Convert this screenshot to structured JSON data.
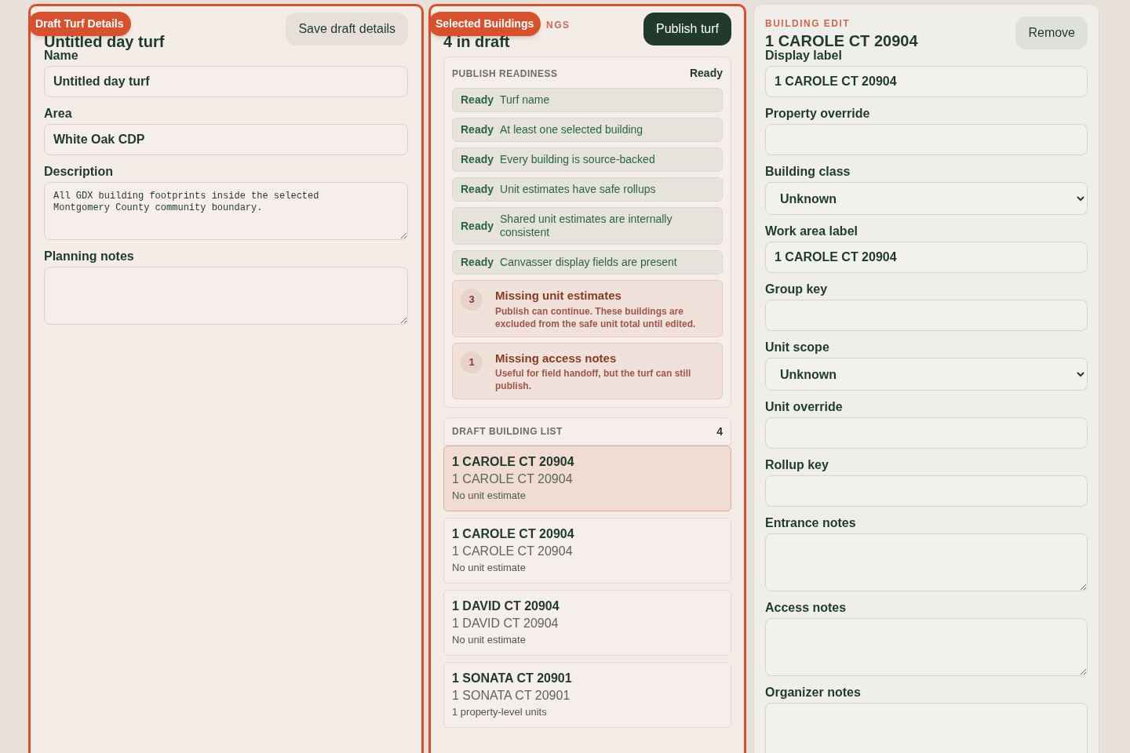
{
  "draft_panel": {
    "badge": "Draft Turf Details",
    "title": "Untitled day turf",
    "button": "Save draft details",
    "highlighted": true,
    "fields": [
      {
        "kind": "input",
        "label": "Name",
        "value": "Untitled day turf"
      },
      {
        "kind": "input",
        "label": "Area",
        "value": "White Oak CDP"
      },
      {
        "kind": "textarea",
        "label": "Description",
        "value": "All GDX building footprints inside the selected Montgomery County community boundary."
      },
      {
        "kind": "textarea",
        "label": "Planning notes"
      }
    ]
  },
  "buildings_panel": {
    "badge": "Selected Buildings",
    "eyebrow": "NGS",
    "title": "4 in draft",
    "button": "Publish turf",
    "highlighted": true,
    "readiness": {
      "heading": "PUBLISH READINESS",
      "status": "Ready",
      "checks": [
        {
          "status": "Ready",
          "label": "Turf name"
        },
        {
          "status": "Ready",
          "label": "At least one selected building"
        },
        {
          "status": "Ready",
          "label": "Every building is source-backed"
        },
        {
          "status": "Ready",
          "label": "Unit estimates have safe rollups"
        },
        {
          "status": "Ready",
          "label": "Shared unit estimates are internally consistent"
        },
        {
          "status": "Ready",
          "label": "Canvasser display fields are present"
        }
      ],
      "warnings": [
        {
          "count": "3",
          "title": "Missing unit estimates",
          "text": "Publish can continue. These buildings are excluded from the safe unit total until edited."
        },
        {
          "count": "1",
          "title": "Missing access notes",
          "text": "Useful for field handoff, but the turf can still publish."
        }
      ]
    },
    "list": {
      "heading": "DRAFT BUILDING LIST",
      "count": "4",
      "items": [
        {
          "title": "1 CAROLE CT 20904",
          "subtitle": "1 CAROLE CT 20904",
          "note": "No unit estimate",
          "selected": true
        },
        {
          "title": "1 CAROLE CT 20904",
          "subtitle": "1 CAROLE CT 20904",
          "note": "No unit estimate",
          "selected": false
        },
        {
          "title": "1 DAVID CT 20904",
          "subtitle": "1 DAVID CT 20904",
          "note": "No unit estimate",
          "selected": false
        },
        {
          "title": "1 SONATA CT 20901",
          "subtitle": "1 SONATA CT 20901",
          "note": "1 property-level units",
          "selected": false
        }
      ]
    }
  },
  "edit_panel": {
    "eyebrow": "BUILDING EDIT",
    "title": "1 CAROLE CT 20904",
    "button": "Remove",
    "fields": [
      {
        "kind": "input",
        "label": "Display label",
        "value": "1 CAROLE CT 20904"
      },
      {
        "kind": "input",
        "label": "Property override"
      },
      {
        "kind": "select",
        "label": "Building class",
        "value": "Unknown"
      },
      {
        "kind": "input",
        "label": "Work area label",
        "value": "1 CAROLE CT 20904"
      },
      {
        "kind": "input",
        "label": "Group key"
      },
      {
        "kind": "select",
        "label": "Unit scope",
        "value": "Unknown"
      },
      {
        "kind": "input",
        "label": "Unit override"
      },
      {
        "kind": "input",
        "label": "Rollup key"
      },
      {
        "kind": "textarea",
        "label": "Entrance notes"
      },
      {
        "kind": "textarea",
        "label": "Access notes"
      },
      {
        "kind": "textarea",
        "label": "Organizer notes"
      }
    ]
  }
}
